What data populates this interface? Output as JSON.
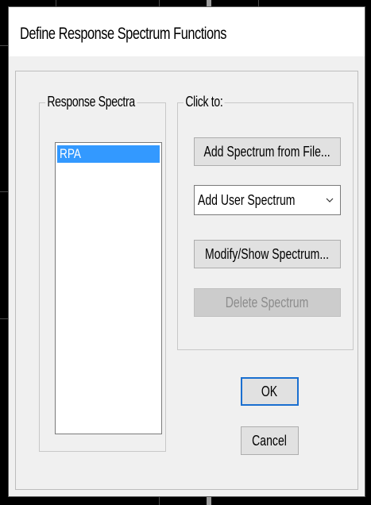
{
  "dialog": {
    "title": "Define Response Spectrum Functions"
  },
  "response_spectra": {
    "label": "Response Spectra",
    "items": [
      "RPA"
    ],
    "selected": "RPA"
  },
  "click_to": {
    "label": "Click to:",
    "add_from_file": "Add Spectrum from File...",
    "add_type_value": "Add User Spectrum",
    "modify_show": "Modify/Show Spectrum...",
    "delete": "Delete Spectrum"
  },
  "buttons": {
    "ok": "OK",
    "cancel": "Cancel"
  },
  "colors": {
    "selection": "#3399ff",
    "focus_border": "#1a6fd0",
    "dialog_bg": "#f0f0f0"
  },
  "icons": {
    "combo_arrow": "chevron-down-icon"
  }
}
